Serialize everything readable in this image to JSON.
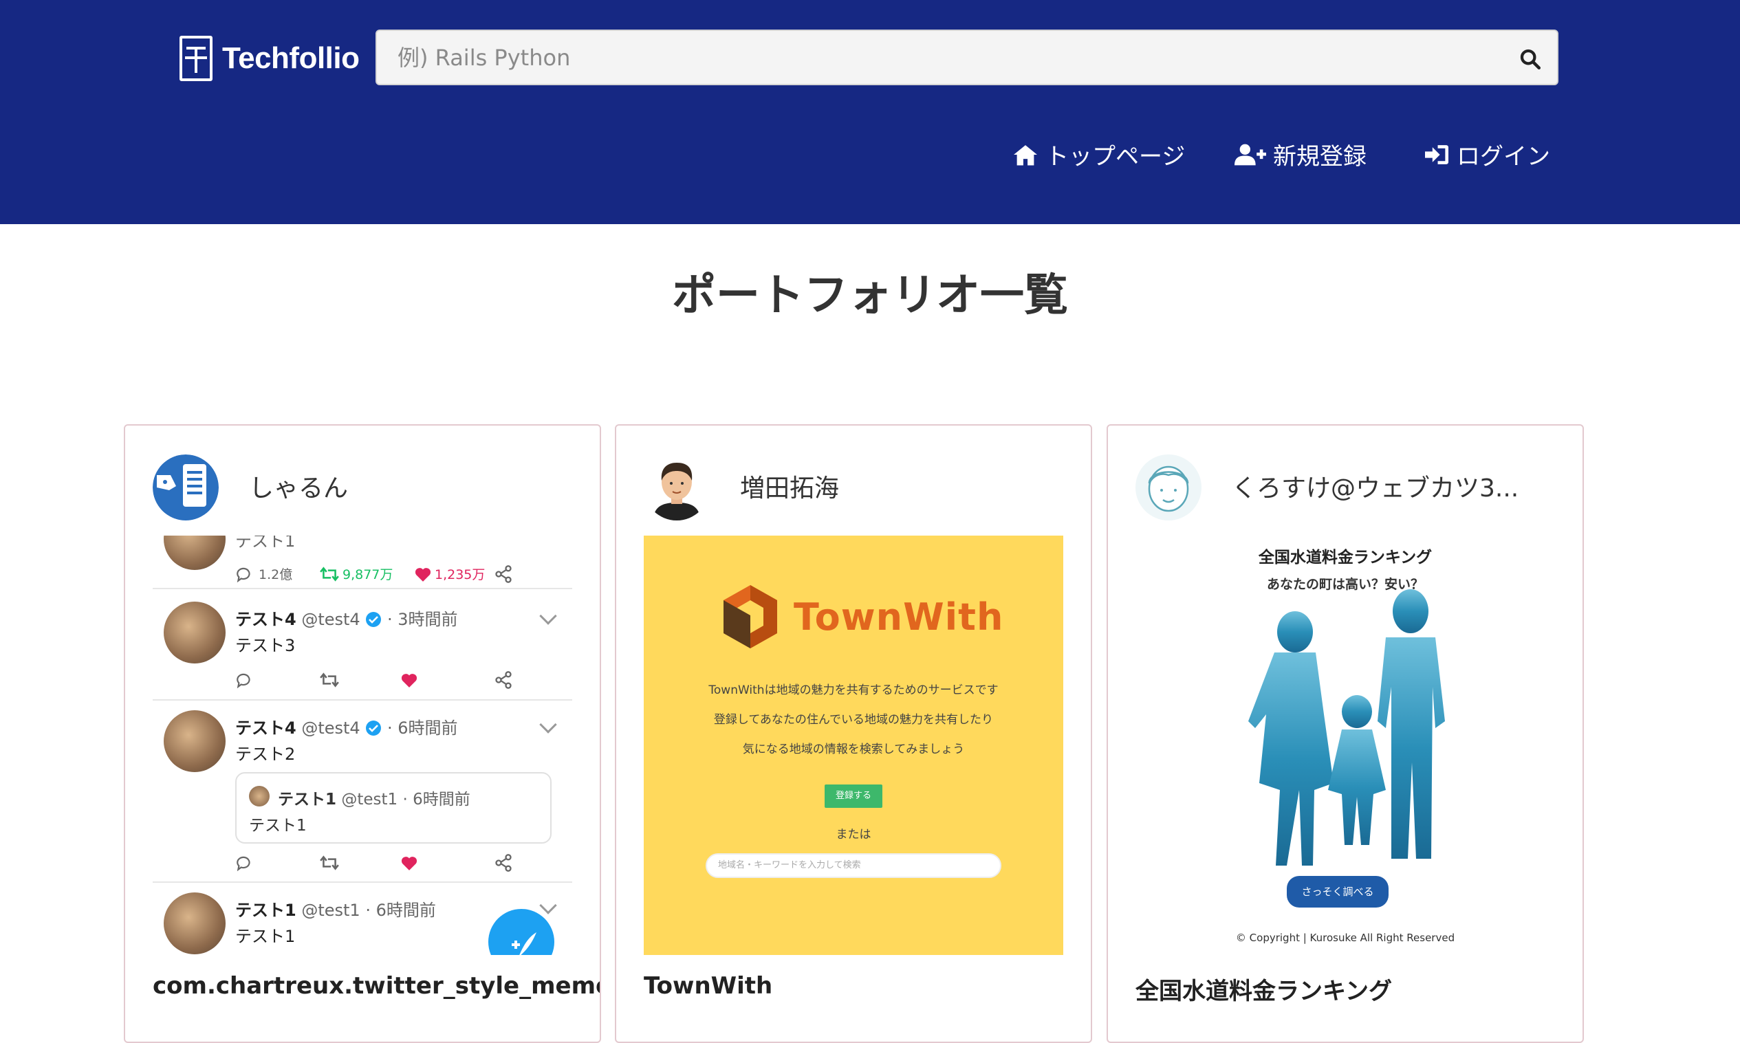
{
  "header": {
    "logo_text": "Techfollio",
    "search_placeholder": "例) Rails Python",
    "nav": {
      "home": "トップページ",
      "signup": "新規登録",
      "login": "ログイン"
    }
  },
  "page_title": "ポートフォリオ一覧",
  "colors": {
    "header_bg": "#162883",
    "card_border": "#e3c9cf",
    "retweet_green": "#17bf63",
    "like_red": "#e0245e",
    "twitter_blue": "#1da1f2",
    "townwith_orange": "#e1661e",
    "townwith_bg": "#ffd95c"
  },
  "cards": [
    {
      "author": "しゃるん",
      "title": "com.chartreux.twitter_style_memo",
      "shot": {
        "partial_text": "テスト1",
        "stats": {
          "replies": "1.2億",
          "retweets": "9,877万",
          "likes": "1,235万"
        },
        "tweets": [
          {
            "name": "テスト4",
            "handle": "@test4",
            "time": "· 3時間前",
            "body": "テスト3"
          },
          {
            "name": "テスト4",
            "handle": "@test4",
            "time": "· 6時間前",
            "body": "テスト2",
            "quote": {
              "name": "テスト1",
              "handle": "@test1",
              "time": "· 6時間前",
              "body": "テスト1"
            }
          },
          {
            "name": "テスト1",
            "handle": "@test1",
            "time": "· 6時間前",
            "body": "テスト1"
          }
        ]
      }
    },
    {
      "author": "増田拓海",
      "title": "TownWith",
      "shot": {
        "brand": "TownWith",
        "lines": [
          "TownWithは地域の魅力を共有するためのサービスです",
          "登録してあなたの住んでいる地域の魅力を共有したり",
          "気になる地域の情報を検索してみましょう"
        ],
        "register_button": "登録する",
        "or_text": "または",
        "search_placeholder": "地域名・キーワードを入力して検索"
      }
    },
    {
      "author": "くろすけ@ウェブカツ3...",
      "title": "全国水道料金ランキング",
      "shot": {
        "heading": "全国水道料金ランキング",
        "subheading": "あなたの町は高い？安い？",
        "button": "さっそく調べる",
        "copyright": "© Copyright | Kurosuke All Right Reserved"
      }
    }
  ]
}
